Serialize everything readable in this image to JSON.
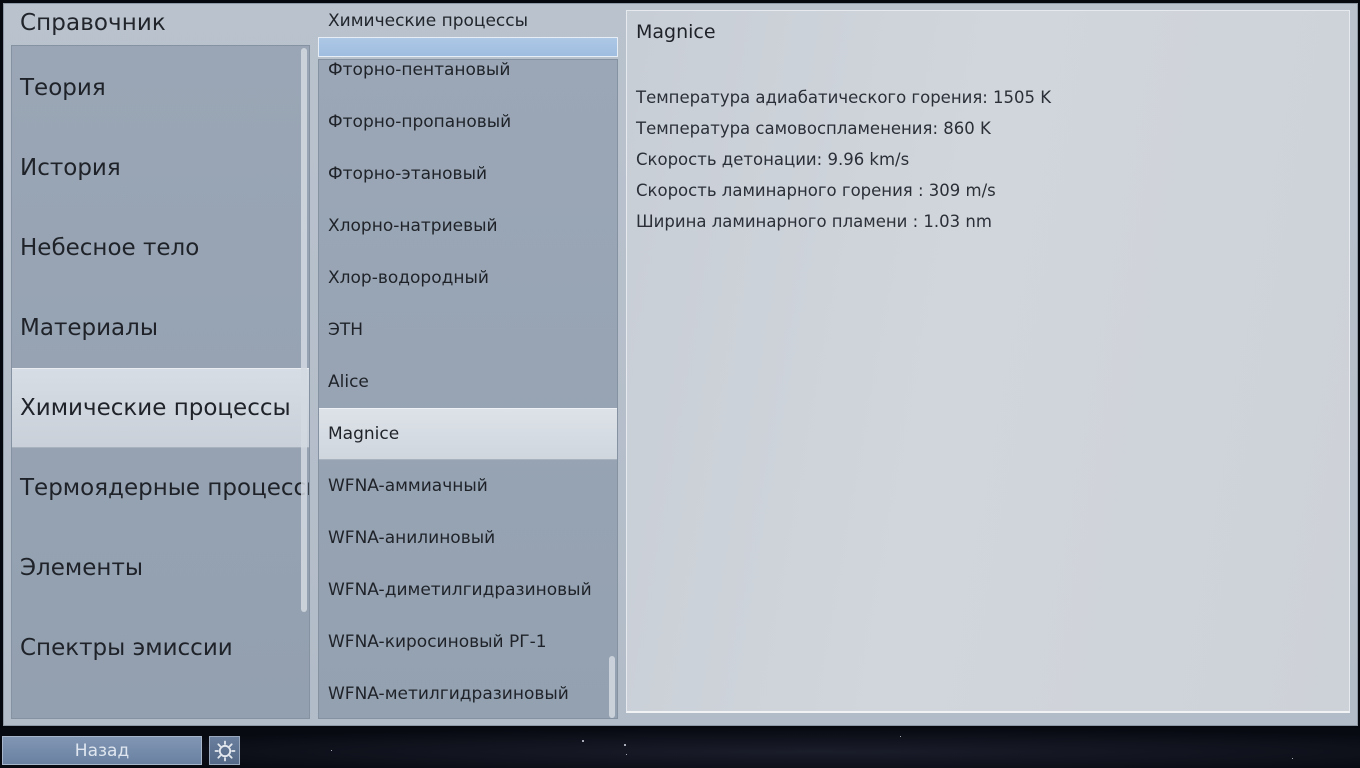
{
  "window": {
    "title": "Справочник"
  },
  "sidebar": {
    "items": [
      {
        "label": "Теория"
      },
      {
        "label": "История"
      },
      {
        "label": "Небесное тело"
      },
      {
        "label": "Материалы"
      },
      {
        "label": "Химические процессы",
        "selected": true
      },
      {
        "label": "Термоядерные процессы"
      },
      {
        "label": "Элементы"
      },
      {
        "label": "Спектры эмиссии"
      }
    ]
  },
  "process_list": {
    "title": "Химические процессы",
    "search_value": "",
    "items": [
      {
        "label": "Фторно-пентановый"
      },
      {
        "label": "Фторно-пропановый"
      },
      {
        "label": "Фторно-этановый"
      },
      {
        "label": "Хлорно-натриевый"
      },
      {
        "label": "Хлор-водородный"
      },
      {
        "label": "ЭТН"
      },
      {
        "label": "Alice"
      },
      {
        "label": "Magnice",
        "selected": true
      },
      {
        "label": "WFNA-аммиачный"
      },
      {
        "label": "WFNA-анилиновый"
      },
      {
        "label": "WFNA-диметилгидразиновый"
      },
      {
        "label": "WFNA-киросиновый РГ-1"
      },
      {
        "label": "WFNA-метилгидразиновый"
      }
    ]
  },
  "detail": {
    "title": "Magnice",
    "properties": [
      "Температура адиабатического горения: 1505 K",
      "Температура самовоспламенения: 860 K",
      "Скорость детонации: 9.96 km/s",
      "Скорость ламинарного горения : 309 m/s",
      "Ширина ламинарного пламени : 1.03 nm"
    ]
  },
  "bottom_bar": {
    "back_label": "Назад",
    "settings_icon": "gear-icon"
  },
  "colors": {
    "selection": "#d3d9e0",
    "search_highlight": "#a6c3e3",
    "back_button": "#768ba9"
  }
}
